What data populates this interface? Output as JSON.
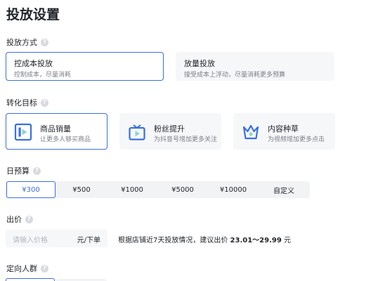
{
  "page_title": "投放设置",
  "placement_method": {
    "label": "投放方式",
    "help_icon": "?",
    "options": [
      {
        "title": "控成本投放",
        "desc": "控制成本，尽量消耗",
        "selected": true
      },
      {
        "title": "放量投放",
        "desc": "接受成本上浮动，尽量消耗更多预算",
        "selected": false
      }
    ]
  },
  "conversion_goal": {
    "label": "转化目标",
    "help_icon": "?",
    "options": [
      {
        "title": "商品销量",
        "desc": "让更多人够买商品",
        "icon": "product-sales-icon",
        "selected": true
      },
      {
        "title": "粉丝提升",
        "desc": "为抖音号增加更多关注",
        "icon": "tv-play-icon",
        "selected": false
      },
      {
        "title": "内容种草",
        "desc": "为视频增加更多点击",
        "icon": "crown-icon",
        "selected": false
      }
    ]
  },
  "daily_budget": {
    "label": "日预算",
    "help_icon": "?",
    "options": [
      "¥300",
      "¥500",
      "¥1000",
      "¥5000",
      "¥10000",
      "自定义"
    ],
    "selected_index": 0
  },
  "bid": {
    "label": "出价",
    "help_icon": "?",
    "placeholder": "请输入价格",
    "unit": "元/下单",
    "hint_prefix": "根据店铺近7天投放情况，建议出价 ",
    "hint_range": "23.01～29.99",
    "hint_suffix": " 元"
  },
  "targeting": {
    "label": "定向人群",
    "help_icon": "?"
  },
  "colors": {
    "accent": "#3a70e0",
    "card_bg": "#f6f7f9",
    "muted_text": "#7a7f87"
  }
}
